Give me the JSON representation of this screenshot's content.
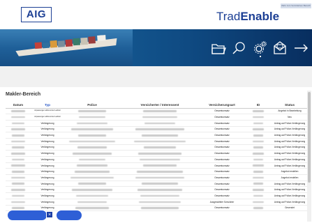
{
  "header": {
    "aig_logo": "AIG",
    "brand_part1": "Trad",
    "brand_part2": "Enable",
    "top_link": "Zahn zum Vermittelnen Bereich"
  },
  "banner": {
    "icons": [
      "folder-icon",
      "search-icon",
      "settings-icon",
      "mail-icon",
      "logout-icon"
    ]
  },
  "section": {
    "title": "Makler-Bereich"
  },
  "table": {
    "columns": [
      "Datum",
      "Typ",
      "Police",
      "Versicherter / Interessent",
      "Versicherungsart",
      "ID",
      "Status"
    ],
    "rows": [
      {
        "typ": "Anpassungen während der Laufzeit",
        "art": "Gesamtumsatz",
        "status": "Angebot in Bearbeitung"
      },
      {
        "typ": "Anpassungen während der Laufzeit",
        "art": "Gesamtumsatz",
        "status": "Neu"
      },
      {
        "typ": "Verlängerung",
        "art": "Gesamtumsatz",
        "status": "Antrag auf Police-Verlängerung"
      },
      {
        "typ": "Verlängerung",
        "art": "Gesamtumsatz",
        "status": "Antrag auf Police-Verlängerung"
      },
      {
        "typ": "Verlängerung",
        "art": "Gesamtumsatz",
        "status": "Antrag auf Police-Verlängerung"
      },
      {
        "typ": "Verlängerung",
        "art": "Gesamtumsatz",
        "status": "Antrag auf Police-Verlängerung"
      },
      {
        "typ": "Verlängerung",
        "art": "Gesamtumsatz",
        "status": "Antrag auf Police-Verlängerung"
      },
      {
        "typ": "Verlängerung",
        "art": "Gesamtumsatz",
        "status": "Antrag auf Police-Verlängerung"
      },
      {
        "typ": "Verlängerung",
        "art": "Gesamtumsatz",
        "status": "Antrag auf Police-Verlängerung"
      },
      {
        "typ": "Verlängerung",
        "art": "Gesamtumsatz",
        "status": "Antrag auf Police-Verlängerung"
      },
      {
        "typ": "Verlängerung",
        "art": "Gesamtumsatz",
        "status": "Angebot erstellen"
      },
      {
        "typ": "Verlängerung",
        "art": "Gesamtumsatz",
        "status": "Angebot erstellen"
      },
      {
        "typ": "Verlängerung",
        "art": "Gesamtumsatz",
        "status": "Antrag auf Police-Verlängerung"
      },
      {
        "typ": "Verlängerung",
        "art": "Gesamtumsatz",
        "status": "Antrag auf Police-Verlängerung"
      },
      {
        "typ": "Verlängerung",
        "art": "Gesamtumsatz",
        "status": "Antrag auf Police-Verlängerung"
      },
      {
        "typ": "Verlängerung",
        "art": "Ausgewählter Schuldner",
        "status": "Antrag auf Police-Verlängerung"
      },
      {
        "typ": "Verlängerung",
        "art": "Gesamtumsatz",
        "status": "Gesendet"
      }
    ]
  },
  "colors": {
    "brand_blue": "#1c3f94",
    "link_blue": "#1d4fc4",
    "button_blue": "#2e5fd6"
  }
}
